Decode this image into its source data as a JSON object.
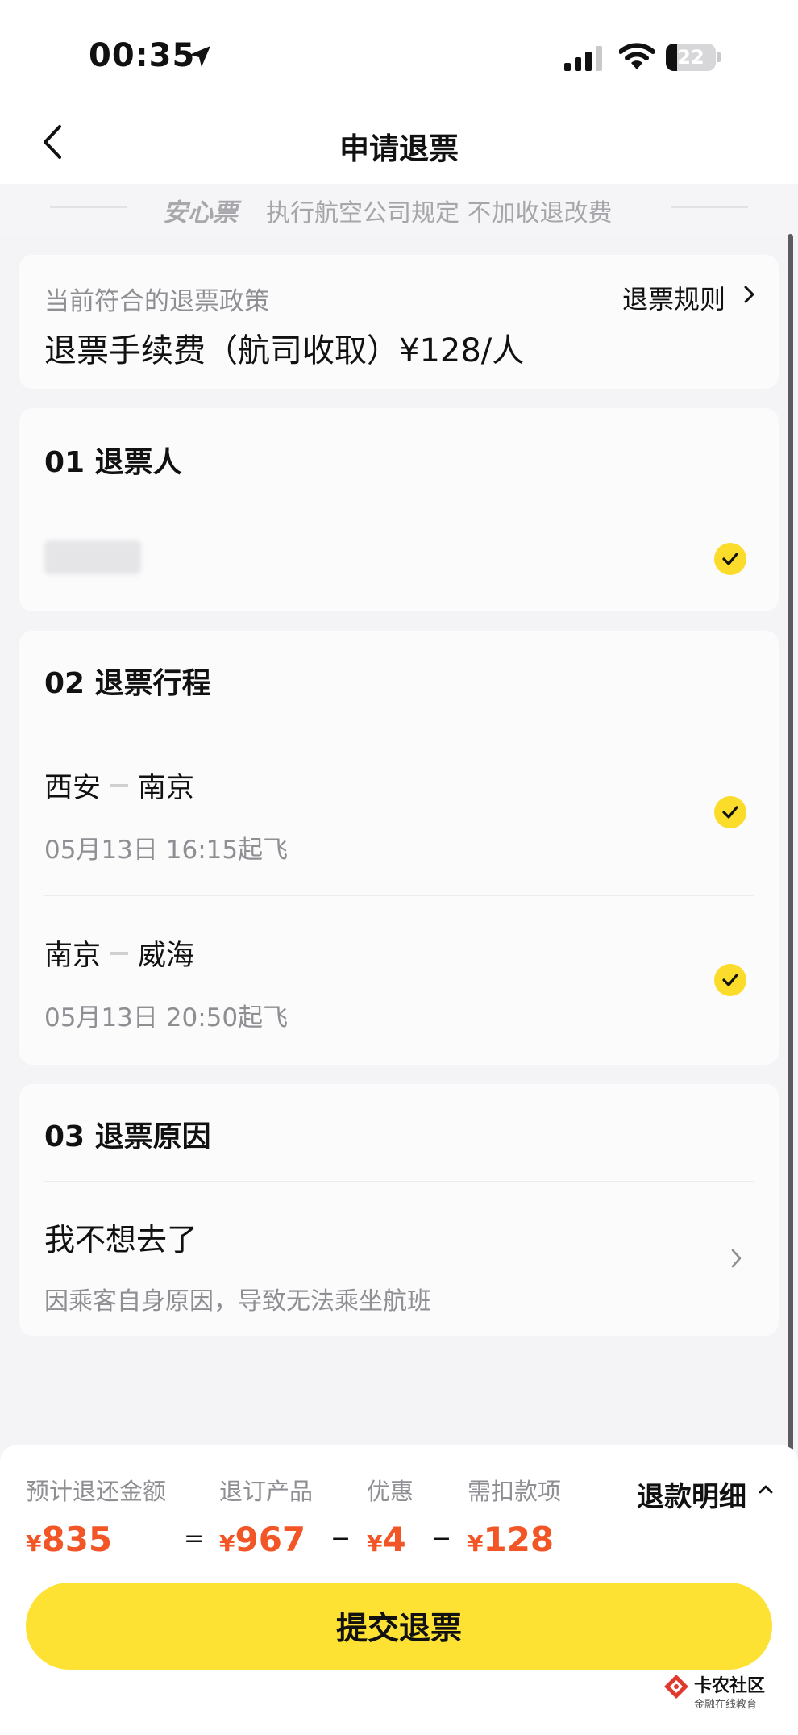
{
  "status_bar": {
    "time": "00:35",
    "battery": "22",
    "battery_level": 0.22
  },
  "header": {
    "title": "申请退票"
  },
  "banner": {
    "tag": "安心票",
    "text": "执行航空公司规定 不加收退改费"
  },
  "policy": {
    "label": "当前符合的退票政策",
    "rules_link": "退票规则",
    "fee": "退票手续费（航司收取）¥128/人"
  },
  "sections": {
    "passenger": {
      "title": "01  退票人",
      "checked": true
    },
    "itinerary": {
      "title": "02  退票行程",
      "flights": [
        {
          "from": "西安",
          "to": "南京",
          "time": "05月13日 16:15起飞",
          "checked": true
        },
        {
          "from": "南京",
          "to": "威海",
          "time": "05月13日 20:50起飞",
          "checked": true
        }
      ]
    },
    "reason": {
      "title": "03  退票原因",
      "value": "我不想去了",
      "sub": "因乘客自身原因，导致无法乘坐航班"
    }
  },
  "refund": {
    "labels": {
      "total": "预计退还金额",
      "product": "退订产品",
      "discount": "优惠",
      "deduct": "需扣款项"
    },
    "currency": "¥",
    "amounts": {
      "total": "835",
      "product": "967",
      "discount": "4",
      "deduct": "128"
    },
    "operators": {
      "eq": "=",
      "minus1": "−",
      "minus2": "−"
    },
    "detail_link": "退款明细"
  },
  "submit_label": "提交退票",
  "watermark": {
    "title": "卡农社区",
    "sub": "金融在线教育"
  },
  "colors": {
    "accent_yellow": "#FDE133",
    "check_yellow": "#FBDC2A",
    "price_orange": "#F25526"
  }
}
